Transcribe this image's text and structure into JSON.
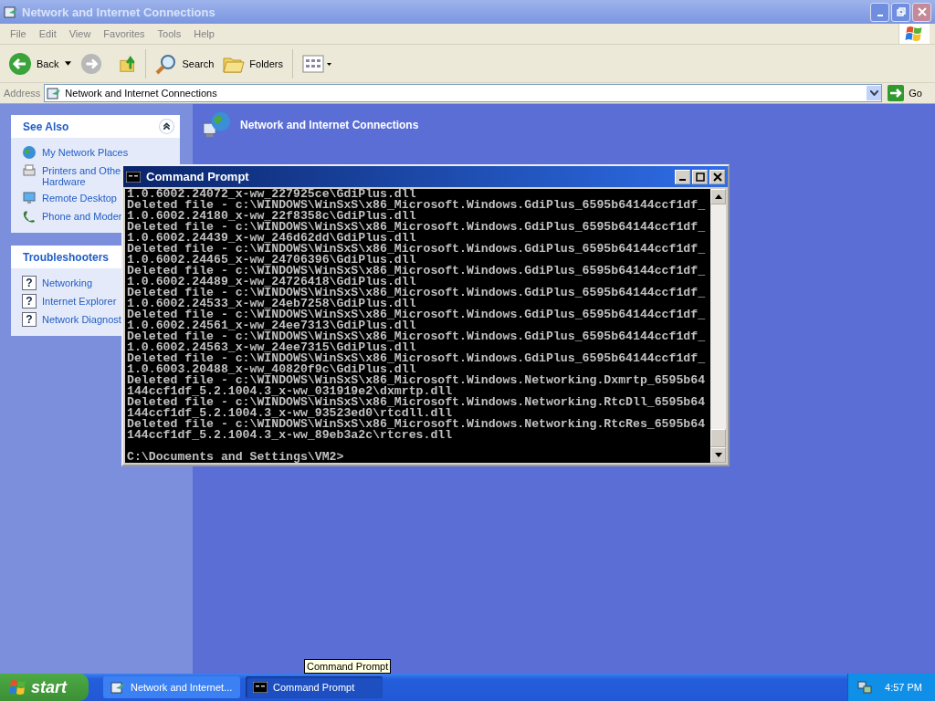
{
  "window": {
    "title": "Network and Internet Connections"
  },
  "menu": [
    "File",
    "Edit",
    "View",
    "Favorites",
    "Tools",
    "Help"
  ],
  "toolbar": {
    "back": "Back",
    "search": "Search",
    "folders": "Folders"
  },
  "address": {
    "label": "Address",
    "value": "Network and Internet Connections",
    "go": "Go"
  },
  "sidebar": [
    {
      "title": "See Also",
      "items": [
        "My Network Places",
        "Printers and Othe",
        "Hardware",
        "Remote Desktop",
        "Phone and Moder"
      ]
    },
    {
      "title": "Troubleshooters",
      "items": [
        {
          "icon": "?",
          "label": "Networking"
        },
        {
          "icon": "?",
          "label": "Internet Explorer"
        },
        {
          "icon": "?",
          "label": "Network Diagnost"
        }
      ]
    }
  ],
  "heading": "Network and Internet Connections",
  "console": {
    "title": "Command Prompt",
    "lines": [
      "1.0.6002.24072_x-ww_227925ce\\GdiPlus.dll",
      "Deleted file - c:\\WINDOWS\\WinSxS\\x86_Microsoft.Windows.GdiPlus_6595b64144ccf1df_",
      "1.0.6002.24180_x-ww_22f8358c\\GdiPlus.dll",
      "Deleted file - c:\\WINDOWS\\WinSxS\\x86_Microsoft.Windows.GdiPlus_6595b64144ccf1df_",
      "1.0.6002.24439_x-ww_246d62dd\\GdiPlus.dll",
      "Deleted file - c:\\WINDOWS\\WinSxS\\x86_Microsoft.Windows.GdiPlus_6595b64144ccf1df_",
      "1.0.6002.24465_x-ww_24706396\\GdiPlus.dll",
      "Deleted file - c:\\WINDOWS\\WinSxS\\x86_Microsoft.Windows.GdiPlus_6595b64144ccf1df_",
      "1.0.6002.24489_x-ww_24726418\\GdiPlus.dll",
      "Deleted file - c:\\WINDOWS\\WinSxS\\x86_Microsoft.Windows.GdiPlus_6595b64144ccf1df_",
      "1.0.6002.24533_x-ww_24eb7258\\GdiPlus.dll",
      "Deleted file - c:\\WINDOWS\\WinSxS\\x86_Microsoft.Windows.GdiPlus_6595b64144ccf1df_",
      "1.0.6002.24561_x-ww_24ee7313\\GdiPlus.dll",
      "Deleted file - c:\\WINDOWS\\WinSxS\\x86_Microsoft.Windows.GdiPlus_6595b64144ccf1df_",
      "1.0.6002.24563_x-ww_24ee7315\\GdiPlus.dll",
      "Deleted file - c:\\WINDOWS\\WinSxS\\x86_Microsoft.Windows.GdiPlus_6595b64144ccf1df_",
      "1.0.6003.20488_x-ww_40820f9c\\GdiPlus.dll",
      "Deleted file - c:\\WINDOWS\\WinSxS\\x86_Microsoft.Windows.Networking.Dxmrtp_6595b64",
      "144ccf1df_5.2.1004.3_x-ww_031919e2\\dxmrtp.dll",
      "Deleted file - c:\\WINDOWS\\WinSxS\\x86_Microsoft.Windows.Networking.RtcDll_6595b64",
      "144ccf1df_5.2.1004.3_x-ww_93523ed0\\rtcdll.dll",
      "Deleted file - c:\\WINDOWS\\WinSxS\\x86_Microsoft.Windows.Networking.RtcRes_6595b64",
      "144ccf1df_5.2.1004.3_x-ww_89eb3a2c\\rtcres.dll"
    ],
    "prompt": "C:\\Documents and Settings\\VM2>"
  },
  "tooltip": "Command Prompt",
  "taskbar": {
    "start": "start",
    "tasks": [
      {
        "label": "Network and Internet...",
        "selected": false
      },
      {
        "label": "Command Prompt",
        "selected": true
      }
    ],
    "clock": "4:57 PM"
  }
}
